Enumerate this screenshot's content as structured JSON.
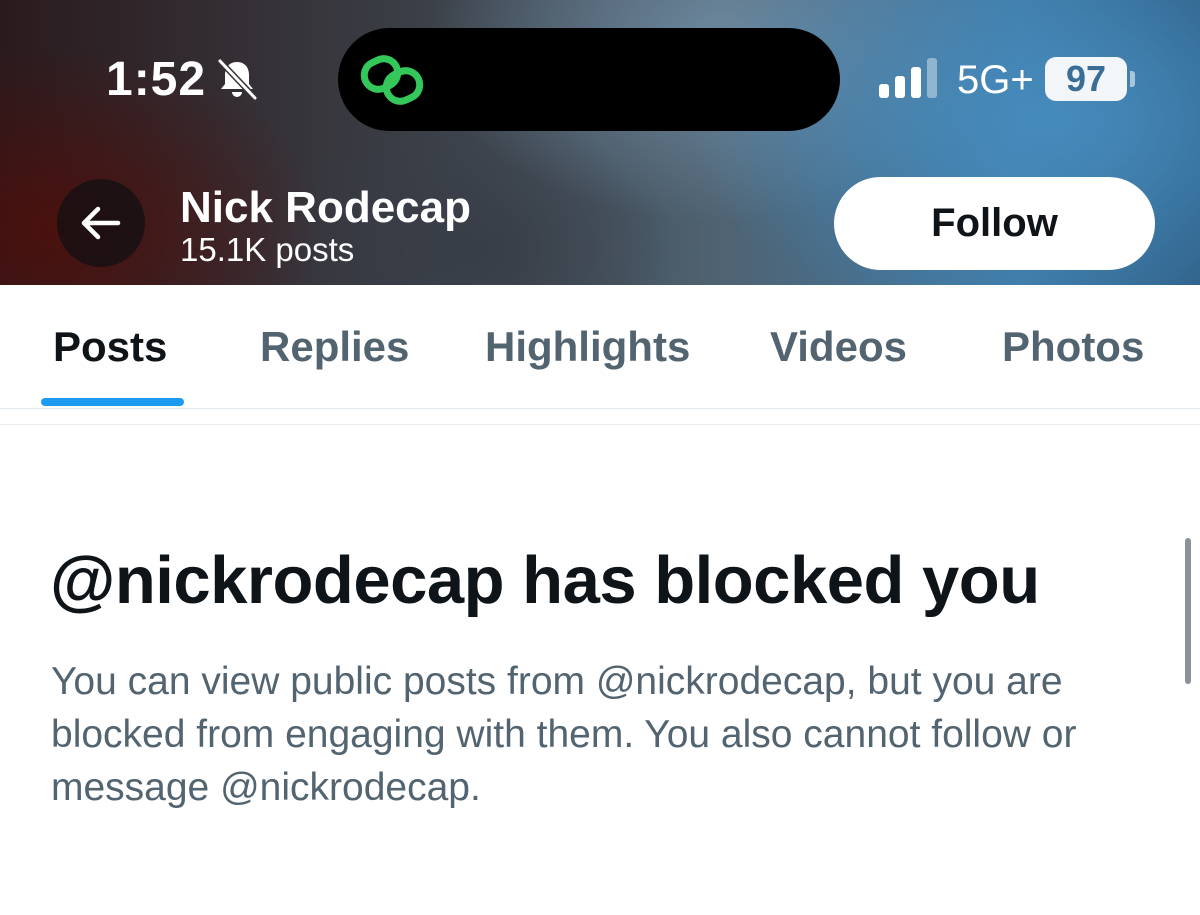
{
  "status_bar": {
    "time": "1:52",
    "network": "5G+",
    "battery_level": "97",
    "accent_color": "#34c759"
  },
  "header": {
    "name": "Nick Rodecap",
    "post_count": "15.1K posts",
    "follow_label": "Follow"
  },
  "tabs": [
    {
      "label": "Posts",
      "active": true
    },
    {
      "label": "Replies",
      "active": false
    },
    {
      "label": "Highlights",
      "active": false
    },
    {
      "label": "Videos",
      "active": false
    },
    {
      "label": "Photos",
      "active": false
    }
  ],
  "blocked": {
    "title": "@nickrodecap has blocked you",
    "body": "You can view public posts from @nickrodecap, but you are blocked from engaging with them. You also cannot follow or message @nickrodecap."
  },
  "colors": {
    "tab_indicator": "#1d9bf0",
    "primary_text": "#0f1419",
    "secondary_text": "#536471"
  }
}
